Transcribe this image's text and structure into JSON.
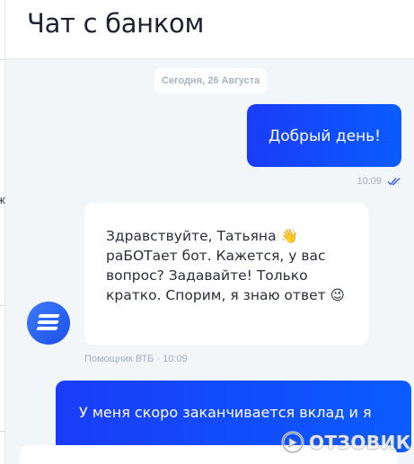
{
  "header": {
    "title": "Чат с банком"
  },
  "chat": {
    "date_chip": "Сегодня, 26 Августа",
    "messages": [
      {
        "from": "user",
        "text": "Добрый день!",
        "time": "10:09",
        "status": "read"
      },
      {
        "from": "bot",
        "text": "Здравствуйте, Татьяна 👋 раБОТает бот. Кажется, у вас вопрос? Задавайте! Только кратко. Спорим, я знаю ответ 😉",
        "sender": "Помощник ВТБ",
        "time": "10:09"
      },
      {
        "from": "user",
        "text": "У меня скоро заканчивается вклад и я"
      }
    ]
  },
  "watermark": {
    "text": "ОТЗОВИК"
  },
  "colors": {
    "accent": "#0a5cff",
    "accent_start": "#1a3cf7",
    "background": "#f3f6f9",
    "meta": "#a3adba"
  },
  "icons": {
    "read_status": "double-check-icon",
    "bot_avatar": "vtb-logo-icon"
  }
}
